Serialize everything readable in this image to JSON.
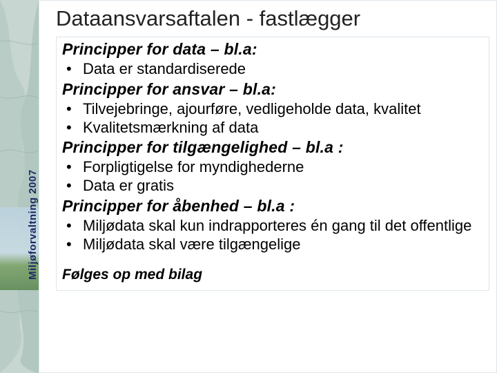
{
  "sidebar": {
    "brand": "Miljøforvaltning 2007"
  },
  "slide": {
    "title": "Dataansvarsaftalen - fastlægger",
    "sections": [
      {
        "heading": "Principper for data – bl.a:",
        "bullets": [
          "Data er standardiserede"
        ]
      },
      {
        "heading": "Principper for ansvar – bl.a:",
        "bullets": [
          "Tilvejebringe, ajourføre, vedligeholde data, kvalitet",
          "Kvalitetsmærkning af data"
        ]
      },
      {
        "heading": "Principper for tilgængelighed – bl.a :",
        "bullets": [
          "Forpligtigelse for myndighederne",
          "Data er gratis"
        ]
      },
      {
        "heading": "Principper for åbenhed – bl.a :",
        "bullets": [
          "Miljødata skal kun indrapporteres én gang til det offentlige",
          "Miljødata skal være tilgængelige"
        ]
      }
    ],
    "followup": "Følges op med bilag"
  }
}
